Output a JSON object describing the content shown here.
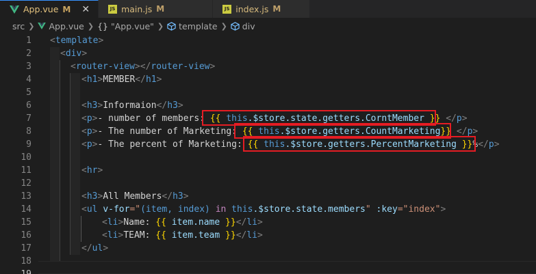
{
  "tabs": [
    {
      "label": "App.vue",
      "modified": "M",
      "icon": "vue-icon",
      "active": true
    },
    {
      "label": "main.js",
      "modified": "M",
      "icon": "js-icon",
      "active": false
    },
    {
      "label": "index.js",
      "modified": "M",
      "icon": "js-icon",
      "active": false
    }
  ],
  "breadcrumb": {
    "items": [
      "src",
      "App.vue",
      "\"App.vue\"",
      "template",
      "div"
    ],
    "braces": "{}"
  },
  "code": {
    "line_numbers": [
      "1",
      "2",
      "3",
      "4",
      "5",
      "6",
      "7",
      "8",
      "9",
      "10",
      "11",
      "12",
      "13",
      "14",
      "15",
      "16",
      "17",
      "18",
      "19"
    ],
    "current_line": "19",
    "lines": {
      "l1": {
        "lt": "<",
        "tag": "template",
        "gt": ">"
      },
      "l2": {
        "lt": "<",
        "tag": "div",
        "gt": ">"
      },
      "l3": {
        "lt": "<",
        "tag": "router-view",
        "mid": "></",
        "tag2": "router-view",
        "gt": ">"
      },
      "l4": {
        "lt": "<",
        "tag": "h1",
        "gt": ">",
        "text": "MEMBER",
        "lt2": "</",
        "tag2": "h1",
        "gt2": ">"
      },
      "l6": {
        "lt": "<",
        "tag": "h3",
        "gt": ">",
        "text": "Informaion",
        "lt2": "</",
        "tag2": "h3",
        "gt2": ">"
      },
      "l7": {
        "tag": "p",
        "text": "- number of members: ",
        "open": "{{",
        "this": "this",
        "expr": ".$store.state.getters.CorntMember",
        "close": "}}",
        "tag2": "p"
      },
      "l8": {
        "tag": "p",
        "text": "- The number of Marketing: ",
        "open": "{{",
        "this": "this",
        "expr": ".$store.getters.CountMarketing",
        "close": "}}",
        "tag2": "p"
      },
      "l9": {
        "tag": "p",
        "text": "- The percent of Marketing: ",
        "open": "{{",
        "this": "this",
        "expr": ".$store.getters.PercentMarketing",
        "close": "}}",
        "after": "%",
        "tag2": "p"
      },
      "l11": {
        "tag": "hr"
      },
      "l13": {
        "tag": "h3",
        "text": "All Members",
        "tag2": "h3"
      },
      "l14": {
        "tag": "ul",
        "vfor": "v-for",
        "eq": "=\"",
        "paren": "(item, index) ",
        "in": "in",
        "this": "this",
        "store": ".$store.state.members",
        "q": "\"",
        "key": ":key",
        "keyval": "=\"index\""
      },
      "l15": {
        "tag": "li",
        "text": "Name: ",
        "open": "{{",
        "expr": "item.name",
        "close": "}}",
        "tag2": "li"
      },
      "l16": {
        "tag": "li",
        "text": "TEAM: ",
        "open": "{{",
        "expr": "item.team",
        "close": "}}",
        "tag2": "li"
      },
      "l17": {
        "tag2": "ul"
      }
    }
  },
  "colors": {
    "highlight_box": "#e51c23",
    "tag": "#569cd6",
    "attribute": "#9cdcfe",
    "string": "#ce9178",
    "keyword": "#c586c0",
    "mustache": "#ffd700",
    "active_tab_text": "#e3c27e"
  }
}
